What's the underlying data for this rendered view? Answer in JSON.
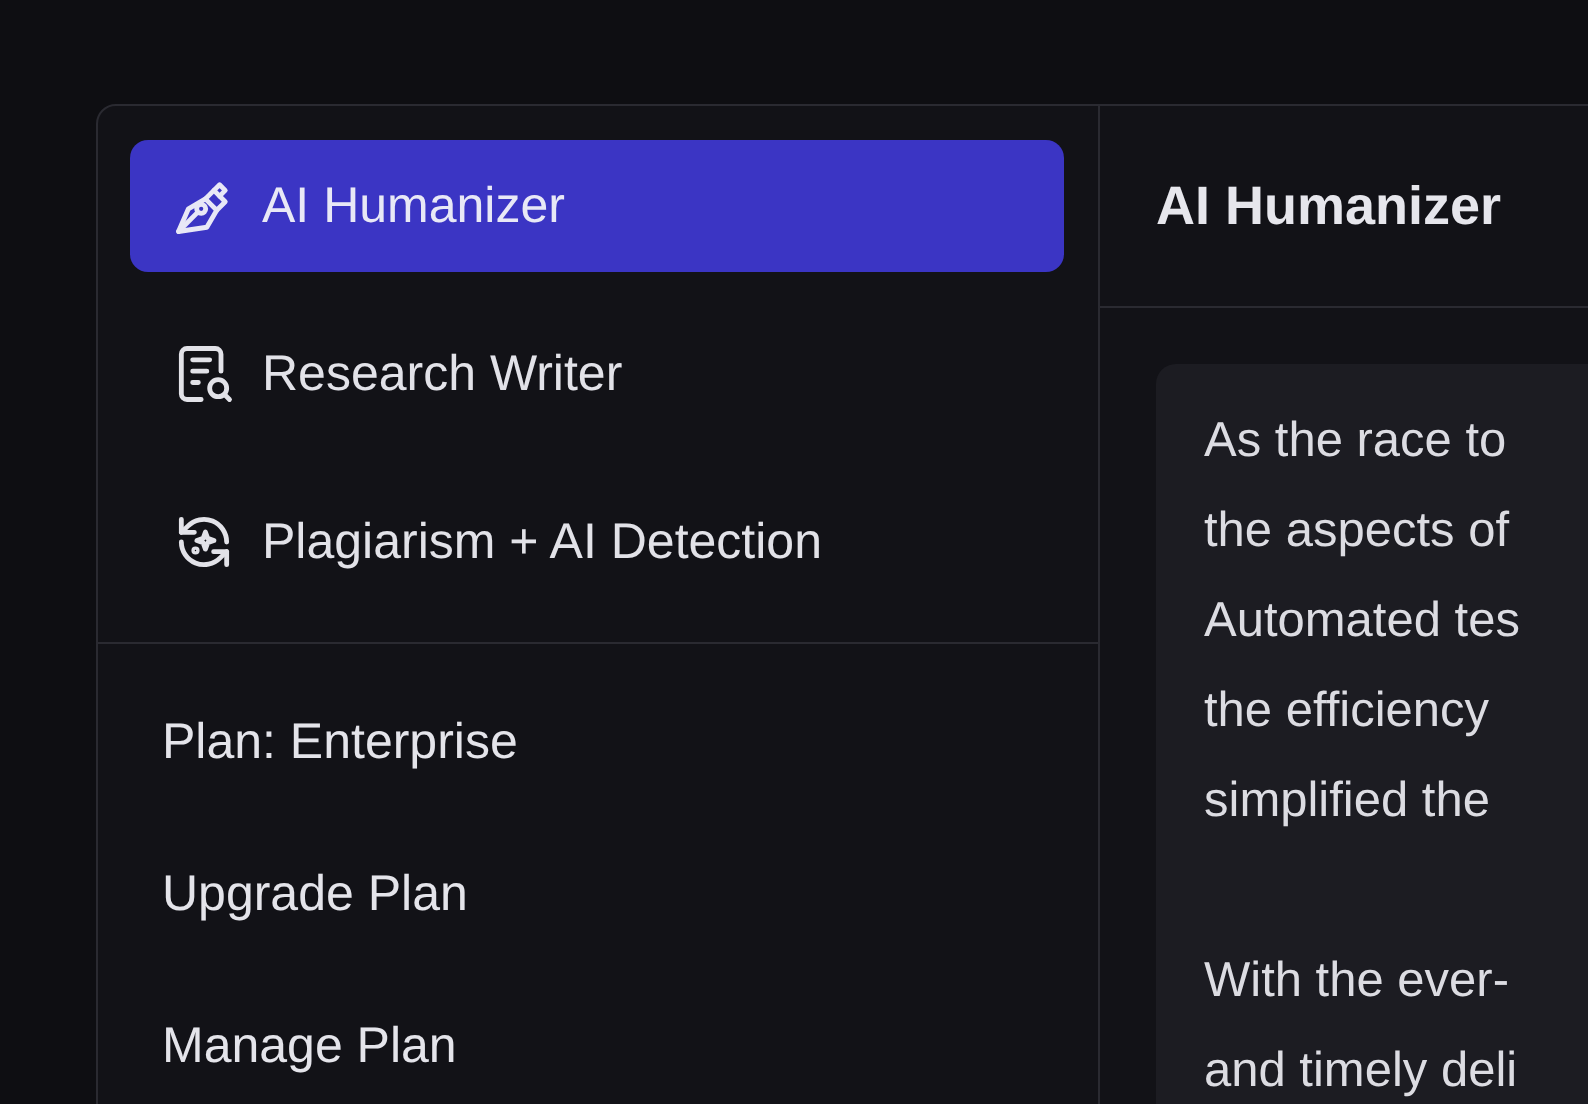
{
  "sidebar": {
    "nav_items": [
      {
        "label": "AI Humanizer",
        "selected": true
      },
      {
        "label": "Research Writer",
        "selected": false
      },
      {
        "label": "Plagiarism + AI Detection",
        "selected": false
      }
    ],
    "plan_items": [
      "Plan: Enterprise",
      "Upgrade Plan",
      "Manage Plan"
    ]
  },
  "main": {
    "title": "AI Humanizer",
    "paragraphs": [
      [
        "As the race to",
        "the aspects of",
        "Automated tes",
        "the efficiency",
        "simplified the"
      ],
      [
        "With the ever-",
        "and timely deli"
      ]
    ]
  }
}
